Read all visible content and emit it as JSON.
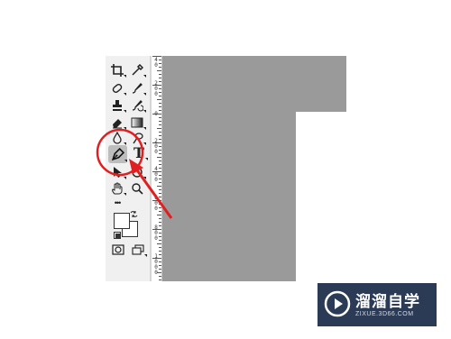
{
  "toolbar": {
    "tools": [
      {
        "name": "crop-tool-icon",
        "active": false
      },
      {
        "name": "eyedropper-tool-icon",
        "active": false
      },
      {
        "name": "healing-brush-tool-icon",
        "active": false
      },
      {
        "name": "brush-tool-icon",
        "active": false
      },
      {
        "name": "clone-stamp-tool-icon",
        "active": false
      },
      {
        "name": "history-brush-tool-icon",
        "active": false
      },
      {
        "name": "eraser-tool-icon",
        "active": false
      },
      {
        "name": "gradient-tool-icon",
        "active": false
      },
      {
        "name": "blur-tool-icon",
        "active": false
      },
      {
        "name": "dodge-tool-icon",
        "active": false
      },
      {
        "name": "pen-tool-icon",
        "active": true
      },
      {
        "name": "type-tool-icon",
        "active": false
      },
      {
        "name": "path-selection-tool-icon",
        "active": false
      },
      {
        "name": "ellipse-tool-icon",
        "active": false
      },
      {
        "name": "hand-tool-icon",
        "active": false
      },
      {
        "name": "zoom-tool-icon",
        "active": false
      },
      {
        "name": "more-tools-icon",
        "active": false
      },
      {
        "name": "quick-mask-icon",
        "active": false
      },
      {
        "name": "screen-mode-icon",
        "active": false
      }
    ],
    "type_glyph": "T",
    "more_glyph": "•••",
    "foreground_color": "#ffffff",
    "background_color": "#ffffff"
  },
  "ruler": {
    "labels": [
      "4\n0",
      "2\n0\n0",
      "0",
      "2\n0\n0",
      "4\n0\n0",
      "6\n0\n0",
      "8\n0\n0",
      "1\n0\n0\n0"
    ]
  },
  "canvas": {
    "color": "#9b9a9b"
  },
  "annotation": {
    "circle_color": "#e02020",
    "arrow_color": "#e02020"
  },
  "watermark": {
    "title": "溜溜自学",
    "url": "ZIXUE.3D66.COM",
    "bg_color": "#2b3a55"
  }
}
